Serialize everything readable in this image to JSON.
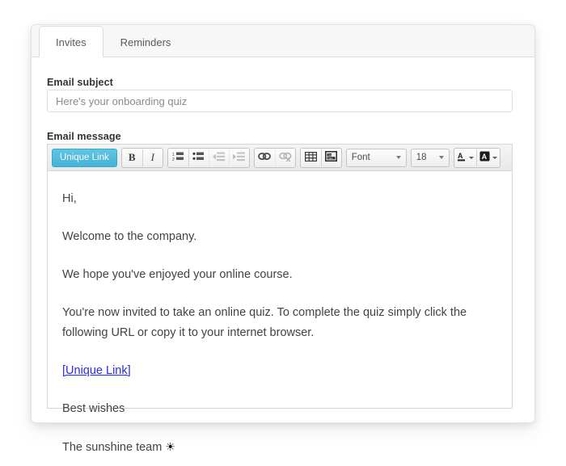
{
  "card": {
    "tabs": [
      {
        "label": "Invites",
        "active": true
      },
      {
        "label": "Reminders",
        "active": false
      }
    ]
  },
  "form": {
    "subject": {
      "label": "Email subject",
      "value": "Here's your onboarding quiz",
      "placeholder": "Here's your onboarding quiz"
    },
    "message": {
      "label": "Email message"
    }
  },
  "toolbar": {
    "unique_link_label": "Unique Link",
    "bold_label": "B",
    "italic_label": "I",
    "numbered_list_icon": "numbered-list-icon",
    "bullet_list_icon": "bullet-list-icon",
    "outdent_icon": "outdent-icon",
    "indent_icon": "indent-icon",
    "link_icon": "link-icon",
    "unlink_icon": "unlink-icon",
    "table_icon": "table-icon",
    "youtube_icon": "youtube-icon",
    "font_select": {
      "value": "Font",
      "options": [
        "Font"
      ]
    },
    "size_select": {
      "value": "18",
      "options": [
        "18"
      ]
    },
    "font_color_label": "A",
    "highlight_color_label": "A",
    "youtube_text_top": "You",
    "youtube_text_bottom": "Tube",
    "accent_color": "#45b4d6",
    "link_color": "#2a2ae6"
  },
  "message_body": {
    "paragraphs": [
      "Hi,",
      "Welcome to the company.",
      "We hope you've enjoyed your online course.",
      "You're now invited to take an online quiz. To complete the quiz simply click the following URL or copy it to your internet browser."
    ],
    "link_text": "[Unique Link]",
    "closing": "Best wishes",
    "signature": "The sunshine team",
    "signature_icon": "☀"
  }
}
